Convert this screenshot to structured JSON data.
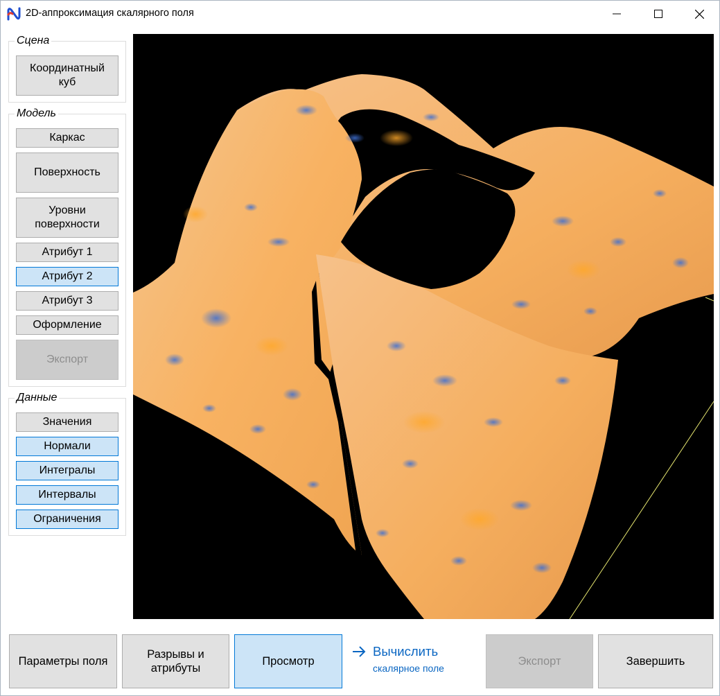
{
  "window": {
    "title": "2D-аппроксимация скалярного поля"
  },
  "colors": {
    "accent": "#0078d7",
    "selected_bg": "#cce4f7",
    "button_bg": "#e1e1e1",
    "link": "#0a66c2",
    "surface_main": "#f7b76a",
    "surface_spots": "#4a78c8"
  },
  "scene": {
    "legend": "Сцена",
    "coord_cube": {
      "line1": "Координатный",
      "line2": "куб"
    }
  },
  "model": {
    "legend": "Модель",
    "wireframe": "Каркас",
    "surface": "Поверхность",
    "levels": {
      "line1": "Уровни",
      "line2": "поверхности"
    },
    "attr1": "Атрибут 1",
    "attr2": "Атрибут 2",
    "attr3": "Атрибут 3",
    "styling": "Оформление",
    "export": "Экспорт"
  },
  "data": {
    "legend": "Данные",
    "values": "Значения",
    "normals": "Нормали",
    "integrals": "Интегралы",
    "intervals": "Интервалы",
    "constraints": "Ограничения"
  },
  "bottom": {
    "field_params": "Параметры поля",
    "breaks": {
      "line1": "Разрывы и",
      "line2": "атрибуты"
    },
    "view": "Просмотр",
    "compute_main": "Вычислить",
    "compute_sub": "скалярное поле",
    "export": "Экспорт",
    "finish": "Завершить"
  },
  "icons": {
    "app": "app-logo-icon",
    "minimize": "minimize-icon",
    "maximize": "maximize-icon",
    "close": "close-icon",
    "arrow": "arrow-right-icon"
  }
}
